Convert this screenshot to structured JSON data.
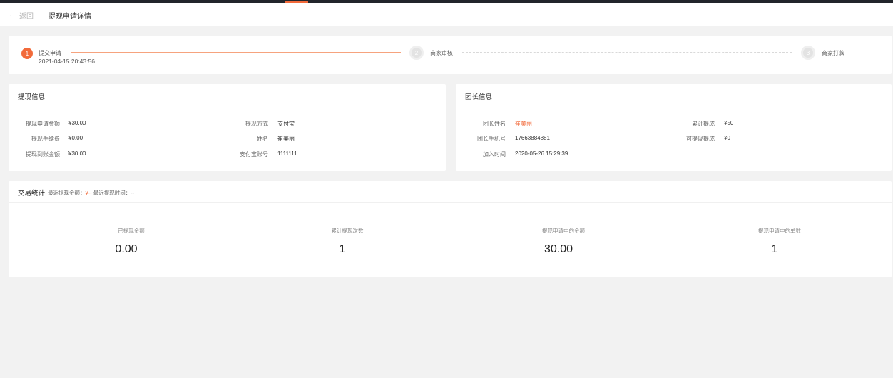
{
  "header": {
    "back_label": "返回",
    "title": "提现申请详情"
  },
  "steps": [
    {
      "index": "1",
      "label": "提交申请",
      "time": "2021-04-15 20:43:56",
      "state": "done"
    },
    {
      "index": "2",
      "label": "商家审核",
      "time": "",
      "state": "pending"
    },
    {
      "index": "3",
      "label": "商家打款",
      "time": "",
      "state": "pending"
    }
  ],
  "withdraw_info": {
    "title": "提现信息",
    "rows": [
      {
        "label": "提现申请金额",
        "value": "¥30.00"
      },
      {
        "label": "提现手续费",
        "value": "¥0.00"
      },
      {
        "label": "提现到账金额",
        "value": "¥30.00"
      },
      {
        "label": "提现方式",
        "value": "支付宝"
      },
      {
        "label": "姓名",
        "value": "崔美丽"
      },
      {
        "label": "支付宝账号",
        "value": "1111111"
      }
    ]
  },
  "leader_info": {
    "title": "团长信息",
    "rows": [
      {
        "label": "团长姓名",
        "value": "崔美丽"
      },
      {
        "label": "团长手机号",
        "value": "17663884881"
      },
      {
        "label": "加入时间",
        "value": "2020-05-26 15:29:39"
      },
      {
        "label": "累计提成",
        "value": "¥50"
      },
      {
        "label": "可提现提成",
        "value": "¥0"
      }
    ]
  },
  "stats": {
    "title": "交易统计",
    "recent_amount_label": "最近提现金额：",
    "recent_amount_value": "¥--",
    "recent_time_label": "最近提现时间：",
    "recent_time_value": "--",
    "items": [
      {
        "label": "已提现金额",
        "value": "0.00"
      },
      {
        "label": "累计提现次数",
        "value": "1"
      },
      {
        "label": "提现申请中的金额",
        "value": "30.00"
      },
      {
        "label": "提现申请中的单数",
        "value": "1"
      }
    ]
  },
  "colors": {
    "accent": "#f26a3a",
    "background": "#f2f2f2",
    "panel": "#ffffff",
    "top_bar": "#22252b"
  },
  "icons": {
    "back": "arrow-left-icon"
  }
}
